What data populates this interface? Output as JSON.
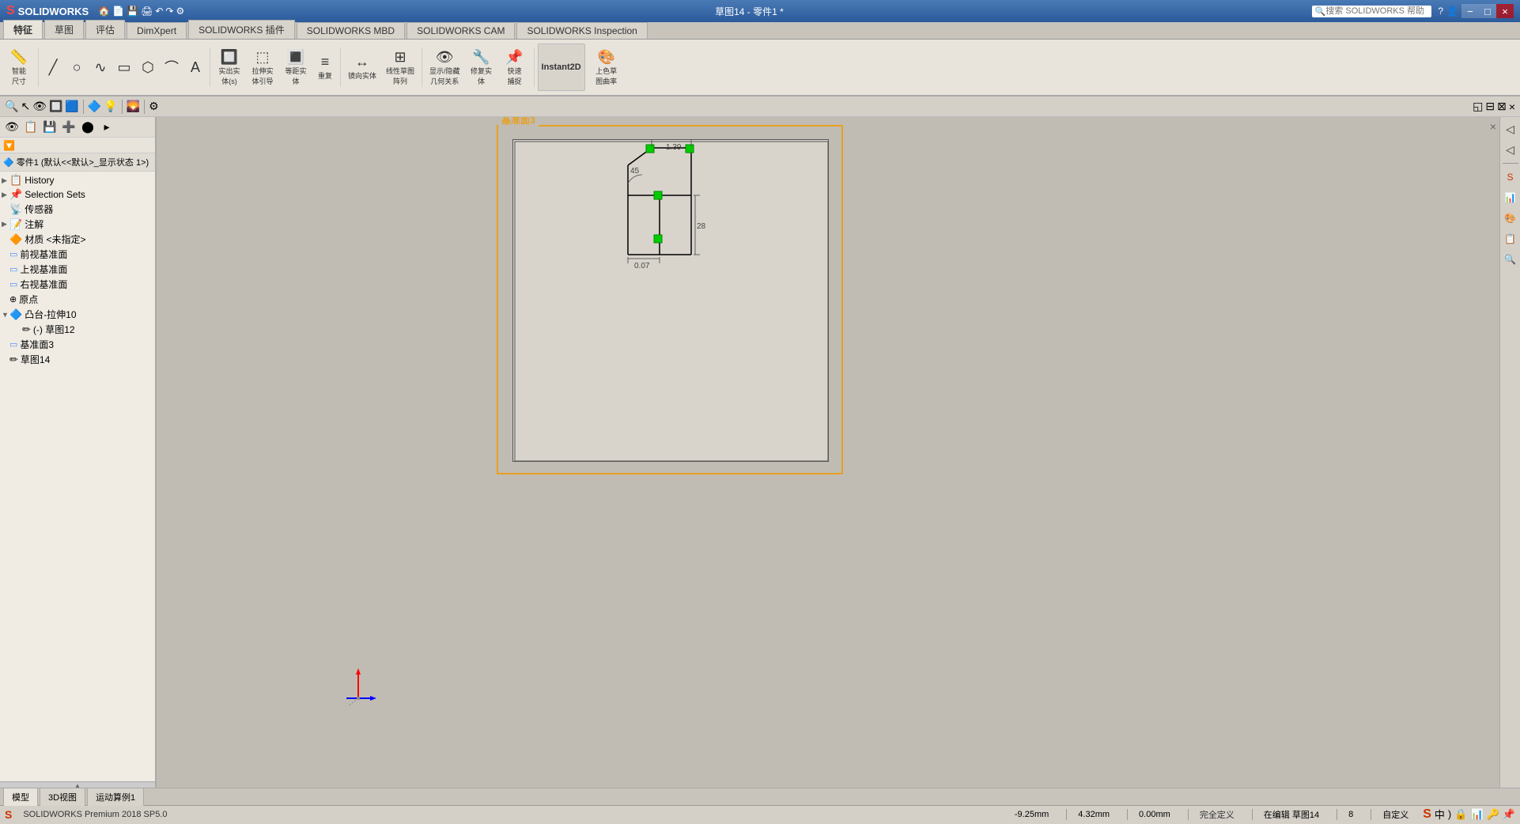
{
  "titleBar": {
    "appName": "SOLIDWORKS",
    "logo": "S",
    "title": "草图14 - 零件1 *",
    "searchPlaceholder": "搜索 SOLIDWORKS 帮助",
    "winControls": [
      "?",
      "−",
      "□",
      "×"
    ]
  },
  "menuBar": {
    "items": [
      "特征",
      "草图",
      "评估",
      "DimXpert",
      "SOLIDWORKS 插件",
      "SOLIDWORKS MBD",
      "SOLIDWORKS CAM",
      "SOLIDWORKS Inspection"
    ]
  },
  "toolbar": {
    "groups": [
      {
        "name": "sketch-tools",
        "buttons": [
          {
            "icon": "⬛",
            "label": "智能\n尺寸"
          },
          {
            "icon": "╱",
            "label": ""
          },
          {
            "icon": "○",
            "label": ""
          },
          {
            "icon": "∿",
            "label": ""
          },
          {
            "icon": "▭",
            "label": ""
          },
          {
            "icon": "◯",
            "label": ""
          },
          {
            "icon": "⌒",
            "label": ""
          },
          {
            "icon": "A",
            "label": ""
          }
        ]
      },
      {
        "name": "sep1"
      },
      {
        "name": "3d-tools",
        "buttons": [
          {
            "icon": "🔲",
            "label": "实出实\n体(s)"
          },
          {
            "icon": "⬚",
            "label": "拉伸实\n体引导"
          },
          {
            "icon": "🔳",
            "label": "等距实\n体"
          },
          {
            "icon": "≡",
            "label": "重复"
          },
          {
            "icon": "📐",
            "label": "镜向实体"
          }
        ]
      },
      {
        "name": "sep2"
      },
      {
        "name": "relation-tools",
        "buttons": [
          {
            "icon": "🔗",
            "label": "线性草图\n阵列"
          },
          {
            "icon": "⚡",
            "label": "显示/隐藏\n几何关系"
          },
          {
            "icon": "🔧",
            "label": "修复实\n体"
          },
          {
            "icon": "📌",
            "label": "快速\n捕捉"
          }
        ]
      },
      {
        "name": "sep3"
      },
      {
        "name": "view-tools",
        "buttons": [
          {
            "icon": "2D",
            "label": "Instant2D"
          },
          {
            "icon": "🎨",
            "label": "上色草\n图曲率"
          }
        ]
      }
    ]
  },
  "leftPanel": {
    "toolbarBtns": [
      "🔍",
      "📋",
      "💾",
      "➕",
      "⬤",
      "▸"
    ],
    "filterLabel": "Filter",
    "partHeader": "零件1 (默认<<默认>_显示状态 1>)",
    "treeItems": [
      {
        "id": "history",
        "label": "History",
        "indent": 0,
        "icon": "📋",
        "expandable": true,
        "expanded": false
      },
      {
        "id": "selection-sets",
        "label": "Selection Sets",
        "indent": 0,
        "icon": "📌",
        "expandable": true
      },
      {
        "id": "sensors",
        "label": "传感器",
        "indent": 0,
        "icon": "📡",
        "expandable": false
      },
      {
        "id": "annotations",
        "label": "注解",
        "indent": 0,
        "icon": "📝",
        "expandable": true
      },
      {
        "id": "material",
        "label": "材质 <未指定>",
        "indent": 0,
        "icon": "🔶",
        "expandable": false
      },
      {
        "id": "front-plane",
        "label": "前视基准面",
        "indent": 0,
        "icon": "▭",
        "expandable": false
      },
      {
        "id": "top-plane",
        "label": "上视基准面",
        "indent": 0,
        "icon": "▭",
        "expandable": false
      },
      {
        "id": "right-plane",
        "label": "右视基准面",
        "indent": 0,
        "icon": "▭",
        "expandable": false
      },
      {
        "id": "origin",
        "label": "原点",
        "indent": 0,
        "icon": "⊕",
        "expandable": false
      },
      {
        "id": "extrude10",
        "label": "凸台-拉伸10",
        "indent": 0,
        "icon": "🔷",
        "expandable": true,
        "expanded": true
      },
      {
        "id": "sketch12",
        "label": "(-) 草图12",
        "indent": 1,
        "icon": "✏",
        "expandable": false
      },
      {
        "id": "base3",
        "label": "基准面3",
        "indent": 0,
        "icon": "▭",
        "expandable": false
      },
      {
        "id": "sketch14",
        "label": "草图14",
        "indent": 0,
        "icon": "✏",
        "expandable": false
      }
    ]
  },
  "canvas": {
    "sheetLabel": "基准面3",
    "dimensions": {
      "d1": "1.39",
      "d2": "45",
      "d3": "28",
      "d4": "0.07"
    }
  },
  "rightPanel": {
    "buttons": [
      "📌",
      "📊",
      "🎨",
      "📋",
      "🔍"
    ]
  },
  "bottomTabs": {
    "tabs": [
      "模型",
      "3D视图",
      "运动算例1"
    ],
    "active": "模型"
  },
  "statusBar": {
    "coords": "-9.25mm",
    "dimension": "4.32mm",
    "status1": "0.00mm",
    "status2": "完全定义",
    "editingLabel": "在编辑 草图14",
    "units": "8",
    "custom": "自定义"
  }
}
